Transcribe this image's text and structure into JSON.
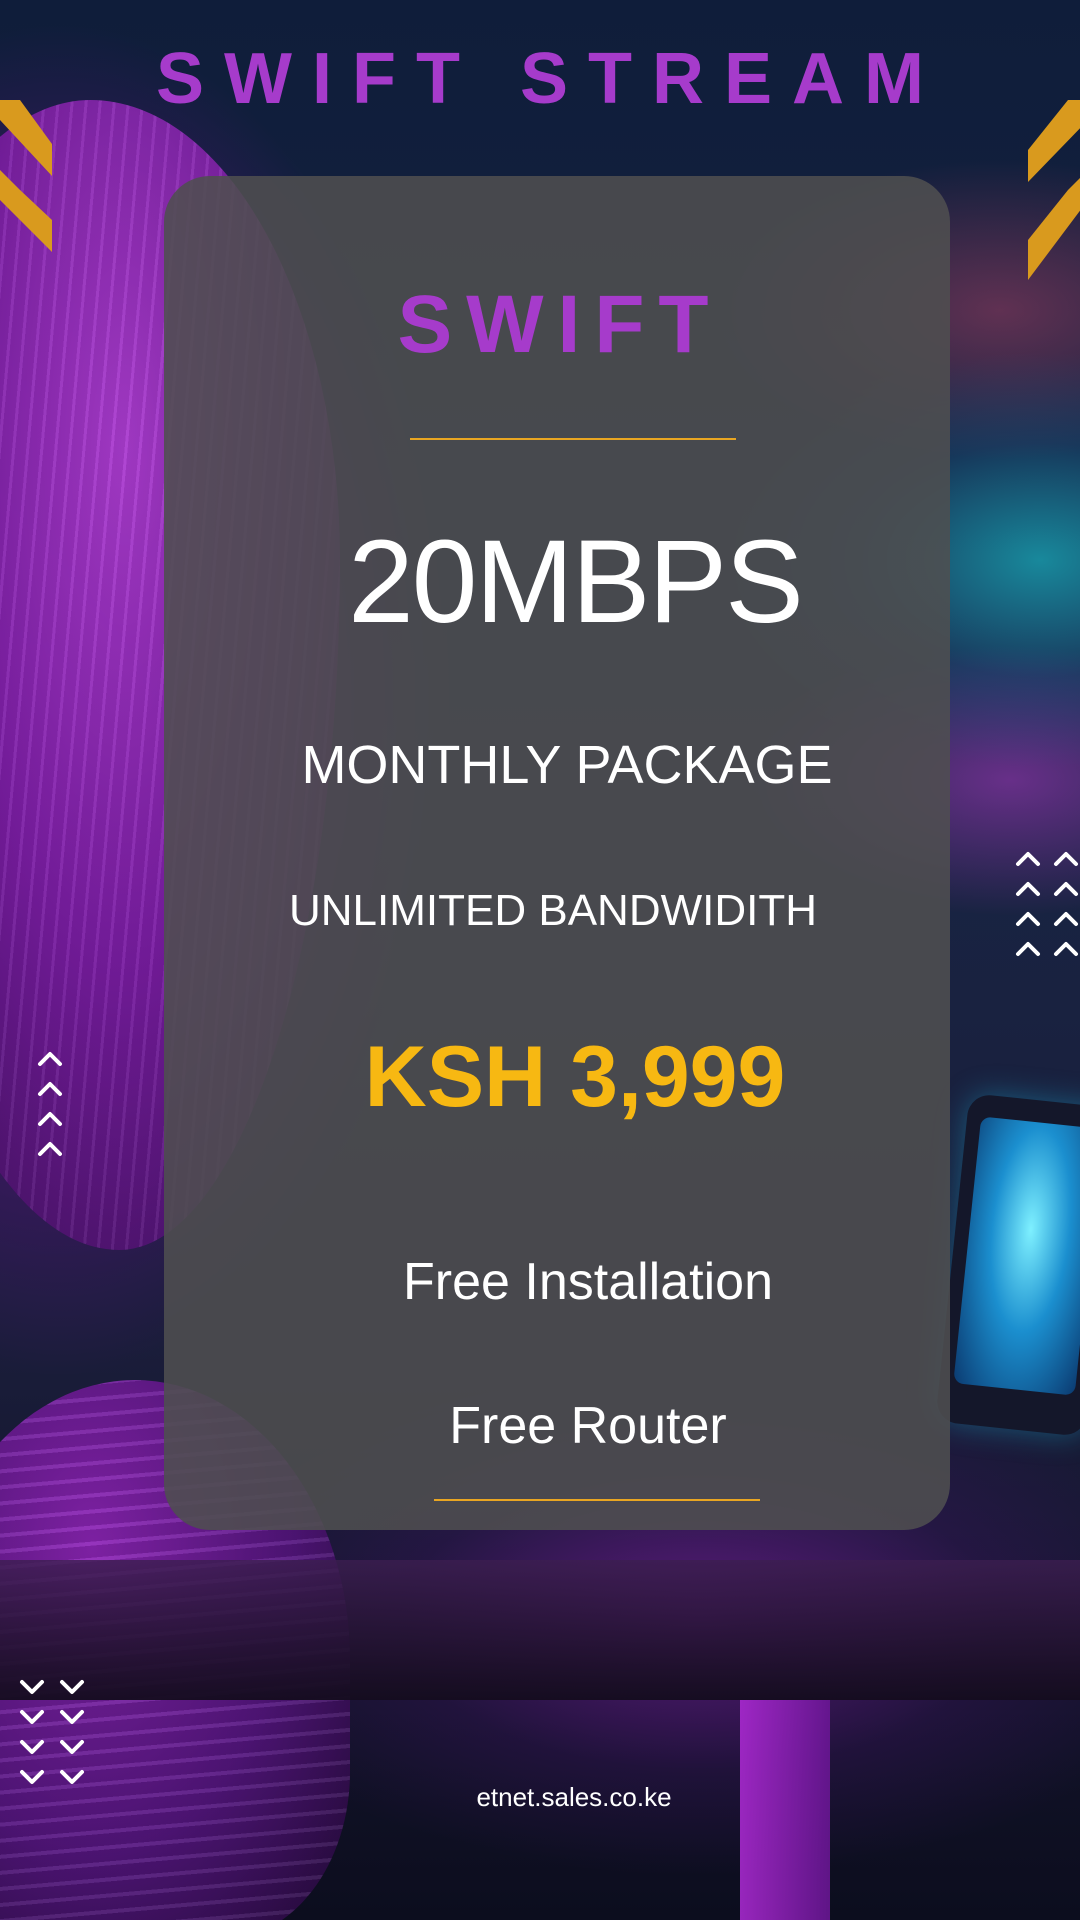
{
  "header": {
    "title": "SWIFT STREAM"
  },
  "card": {
    "brand": "SWIFT",
    "speed": "20MBPS",
    "package": "MONTHLY PACKAGE",
    "bandwidth": "UNLIMITED BANDWIDITH",
    "price": "KSH 3,999",
    "features": [
      "Free Installation",
      "Free Router"
    ]
  },
  "footer": {
    "website": "etnet.sales.co.ke"
  },
  "colors": {
    "brand_purple": "#a63bcb",
    "price_yellow": "#f7b812",
    "accent_gold": "#e9a622",
    "card_grey": "#4e4e50",
    "text_white": "#ffffff"
  },
  "icons": {
    "chevron_up": "^",
    "chevron_down": "v"
  }
}
